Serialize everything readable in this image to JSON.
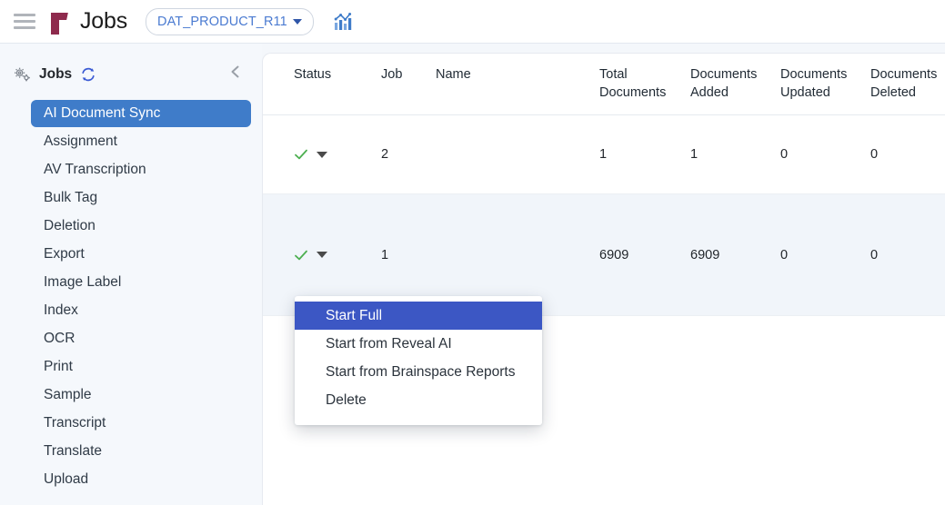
{
  "header": {
    "menu_icon": "hamburger-icon",
    "logo_icon": "reveal-logo-icon",
    "title": "Jobs",
    "project_selector": {
      "value": "DAT_PRODUCT_R11",
      "caret_icon": "caret-down-icon"
    },
    "analytics_icon": "bar-chart-icon"
  },
  "sidebar": {
    "settings_icon": "gears-icon",
    "title": "Jobs",
    "refresh_icon": "refresh-icon",
    "collapse_icon": "chevron-left-icon",
    "items": [
      {
        "label": "AI Document Sync",
        "active": true
      },
      {
        "label": "Assignment",
        "active": false
      },
      {
        "label": "AV Transcription",
        "active": false
      },
      {
        "label": "Bulk Tag",
        "active": false
      },
      {
        "label": "Deletion",
        "active": false
      },
      {
        "label": "Export",
        "active": false
      },
      {
        "label": "Image Label",
        "active": false
      },
      {
        "label": "Index",
        "active": false
      },
      {
        "label": "OCR",
        "active": false
      },
      {
        "label": "Print",
        "active": false
      },
      {
        "label": "Sample",
        "active": false
      },
      {
        "label": "Transcript",
        "active": false
      },
      {
        "label": "Translate",
        "active": false
      },
      {
        "label": "Upload",
        "active": false
      }
    ]
  },
  "table": {
    "columns": [
      {
        "label": "Status"
      },
      {
        "label": "Job"
      },
      {
        "label": "Name"
      },
      {
        "label": "Total Documents"
      },
      {
        "label": "Documents Added"
      },
      {
        "label": "Documents Updated"
      },
      {
        "label": "Documents Deleted"
      }
    ],
    "rows": [
      {
        "status_icon": "green-check-icon",
        "status_caret_icon": "caret-down-icon",
        "job": "2",
        "name": "",
        "total_documents": "1",
        "documents_added": "1",
        "documents_updated": "0",
        "documents_deleted": "0",
        "highlighted": false
      },
      {
        "status_icon": "green-check-icon",
        "status_caret_icon": "caret-down-icon",
        "job": "1",
        "name": "",
        "total_documents": "6909",
        "documents_added": "6909",
        "documents_updated": "0",
        "documents_deleted": "0",
        "highlighted": true
      }
    ]
  },
  "context_menu": {
    "items": [
      {
        "label": "Start Full",
        "highlighted": true
      },
      {
        "label": "Start from Reveal AI",
        "highlighted": false
      },
      {
        "label": "Start from Brainspace Reports",
        "highlighted": false
      },
      {
        "label": "Delete",
        "highlighted": false
      }
    ]
  },
  "colors": {
    "accent_blue": "#3f7cc9",
    "menu_highlight": "#3c57c4",
    "brand_maroon": "#8e2a4d",
    "status_green": "#4caf50",
    "row_highlight": "#f1f5fa",
    "pill_text": "#4b7bd1"
  }
}
